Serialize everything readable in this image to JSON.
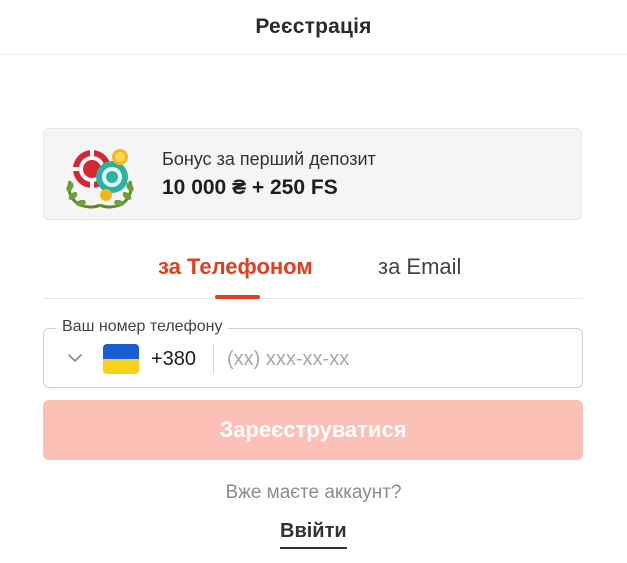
{
  "header": {
    "title": "Реєстрація"
  },
  "bonus": {
    "icon": "casino-chips-laurel-icon",
    "subtitle": "Бонус за перший депозит",
    "amount": "10 000 ₴ + 250 FS"
  },
  "tabs": [
    {
      "label": "за Телефоном",
      "active": true
    },
    {
      "label": "за Email",
      "active": false
    }
  ],
  "phone": {
    "legend": "Ваш номер телефону",
    "country_flag": "ukraine-flag-icon",
    "dial_code": "+380",
    "placeholder": "(xx) xxx-xx-xx",
    "value": ""
  },
  "submit": {
    "label": "Зареєструватися"
  },
  "footer": {
    "prompt": "Вже маєте аккаунт?",
    "login_label": "Ввійти"
  },
  "colors": {
    "accent": "#e2401c",
    "button_disabled": "#fcc0b6",
    "card_background": "#f5f5f5"
  }
}
